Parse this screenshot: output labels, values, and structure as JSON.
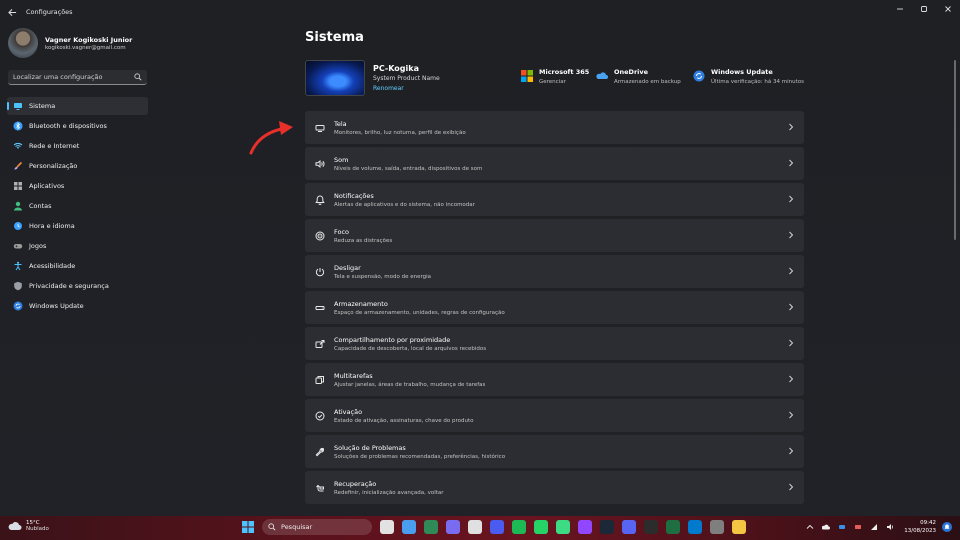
{
  "window": {
    "title": "Configurações"
  },
  "profile": {
    "name": "Vagner Kogikoski Junior",
    "email": "kogikoski.vagner@gmail.com"
  },
  "search": {
    "placeholder": "Localizar uma configuração"
  },
  "nav": {
    "items": [
      {
        "label": "Sistema",
        "icon": "monitor-icon",
        "color": "#4cc2ff"
      },
      {
        "label": "Bluetooth e dispositivos",
        "icon": "bluetooth-icon",
        "color": "#3aa0ff"
      },
      {
        "label": "Rede e Internet",
        "icon": "wifi-icon",
        "color": "#5cc8ff"
      },
      {
        "label": "Personalização",
        "icon": "brush-icon",
        "color": "#f0883e"
      },
      {
        "label": "Aplicativos",
        "icon": "apps-icon",
        "color": "#b0b0b0"
      },
      {
        "label": "Contas",
        "icon": "person-icon",
        "color": "#3fbf7f"
      },
      {
        "label": "Hora e idioma",
        "icon": "globe-clock-icon",
        "color": "#3aa0ff"
      },
      {
        "label": "Jogos",
        "icon": "gamepad-icon",
        "color": "#9a9a9a"
      },
      {
        "label": "Acessibilidade",
        "icon": "accessibility-icon",
        "color": "#4cc2ff"
      },
      {
        "label": "Privacidade e segurança",
        "icon": "shield-icon",
        "color": "#9aa0a6"
      },
      {
        "label": "Windows Update",
        "icon": "update-icon",
        "color": "#2f7fe0"
      }
    ]
  },
  "main": {
    "title": "Sistema",
    "device": {
      "name": "PC-Kogika",
      "model": "System Product Name",
      "rename": "Renomear"
    },
    "quick": [
      {
        "title": "Microsoft 365",
        "sub": "Gerenciar",
        "icon": "microsoft365-icon"
      },
      {
        "title": "OneDrive",
        "sub": "Armazenado em backup",
        "icon": "onedrive-icon"
      },
      {
        "title": "Windows Update",
        "sub": "Última verificação: há 34 minutos",
        "icon": "windows-update-icon"
      }
    ],
    "settings": [
      {
        "title": "Tela",
        "desc": "Monitores, brilho, luz noturna, perfil de exibição",
        "icon": "display-icon"
      },
      {
        "title": "Som",
        "desc": "Níveis de volume, saída, entrada, dispositivos de som",
        "icon": "speaker-icon"
      },
      {
        "title": "Notificações",
        "desc": "Alertas de aplicativos e do sistema, não incomodar",
        "icon": "bell-icon"
      },
      {
        "title": "Foco",
        "desc": "Reduza as distrações",
        "icon": "focus-icon"
      },
      {
        "title": "Desligar",
        "desc": "Tela e suspensão, modo de energia",
        "icon": "power-icon"
      },
      {
        "title": "Armazenamento",
        "desc": "Espaço de armazenamento, unidades, regras de configuração",
        "icon": "storage-icon"
      },
      {
        "title": "Compartilhamento por proximidade",
        "desc": "Capacidade de descoberta, local de arquivos recebidos",
        "icon": "share-icon"
      },
      {
        "title": "Multitarefas",
        "desc": "Ajustar janelas, áreas de trabalho, mudança de tarefas",
        "icon": "multitask-icon"
      },
      {
        "title": "Ativação",
        "desc": "Estado de ativação, assinaturas, chave do produto",
        "icon": "check-circle-icon"
      },
      {
        "title": "Solução de Problemas",
        "desc": "Soluções de problemas recomendadas, preferências, histórico",
        "icon": "wrench-icon"
      },
      {
        "title": "Recuperação",
        "desc": "Redefinir, inicialização avançada, voltar",
        "icon": "recovery-icon"
      }
    ]
  },
  "taskbar": {
    "weather": {
      "temp": "15°C",
      "desc": "Nublado"
    },
    "search": "Pesquisar",
    "apps": [
      "#e2e2e2",
      "#4a9ef0",
      "#2e8b57",
      "#7a6cf0",
      "#e0e0e0",
      "#4a5cf0",
      "#1db954",
      "#25d366",
      "#3ddc84",
      "#9146ff",
      "#1b2838",
      "#5865f2",
      "#2c2c2c",
      "#1d6f42",
      "#007acc",
      "#7f7f7f",
      "#f4c542"
    ],
    "clock": {
      "time": "09:42",
      "date": "13/08/2023"
    }
  },
  "colors": {
    "accent": "#4cc2ff",
    "link": "#60cdff",
    "arrow": "#e8302a"
  }
}
